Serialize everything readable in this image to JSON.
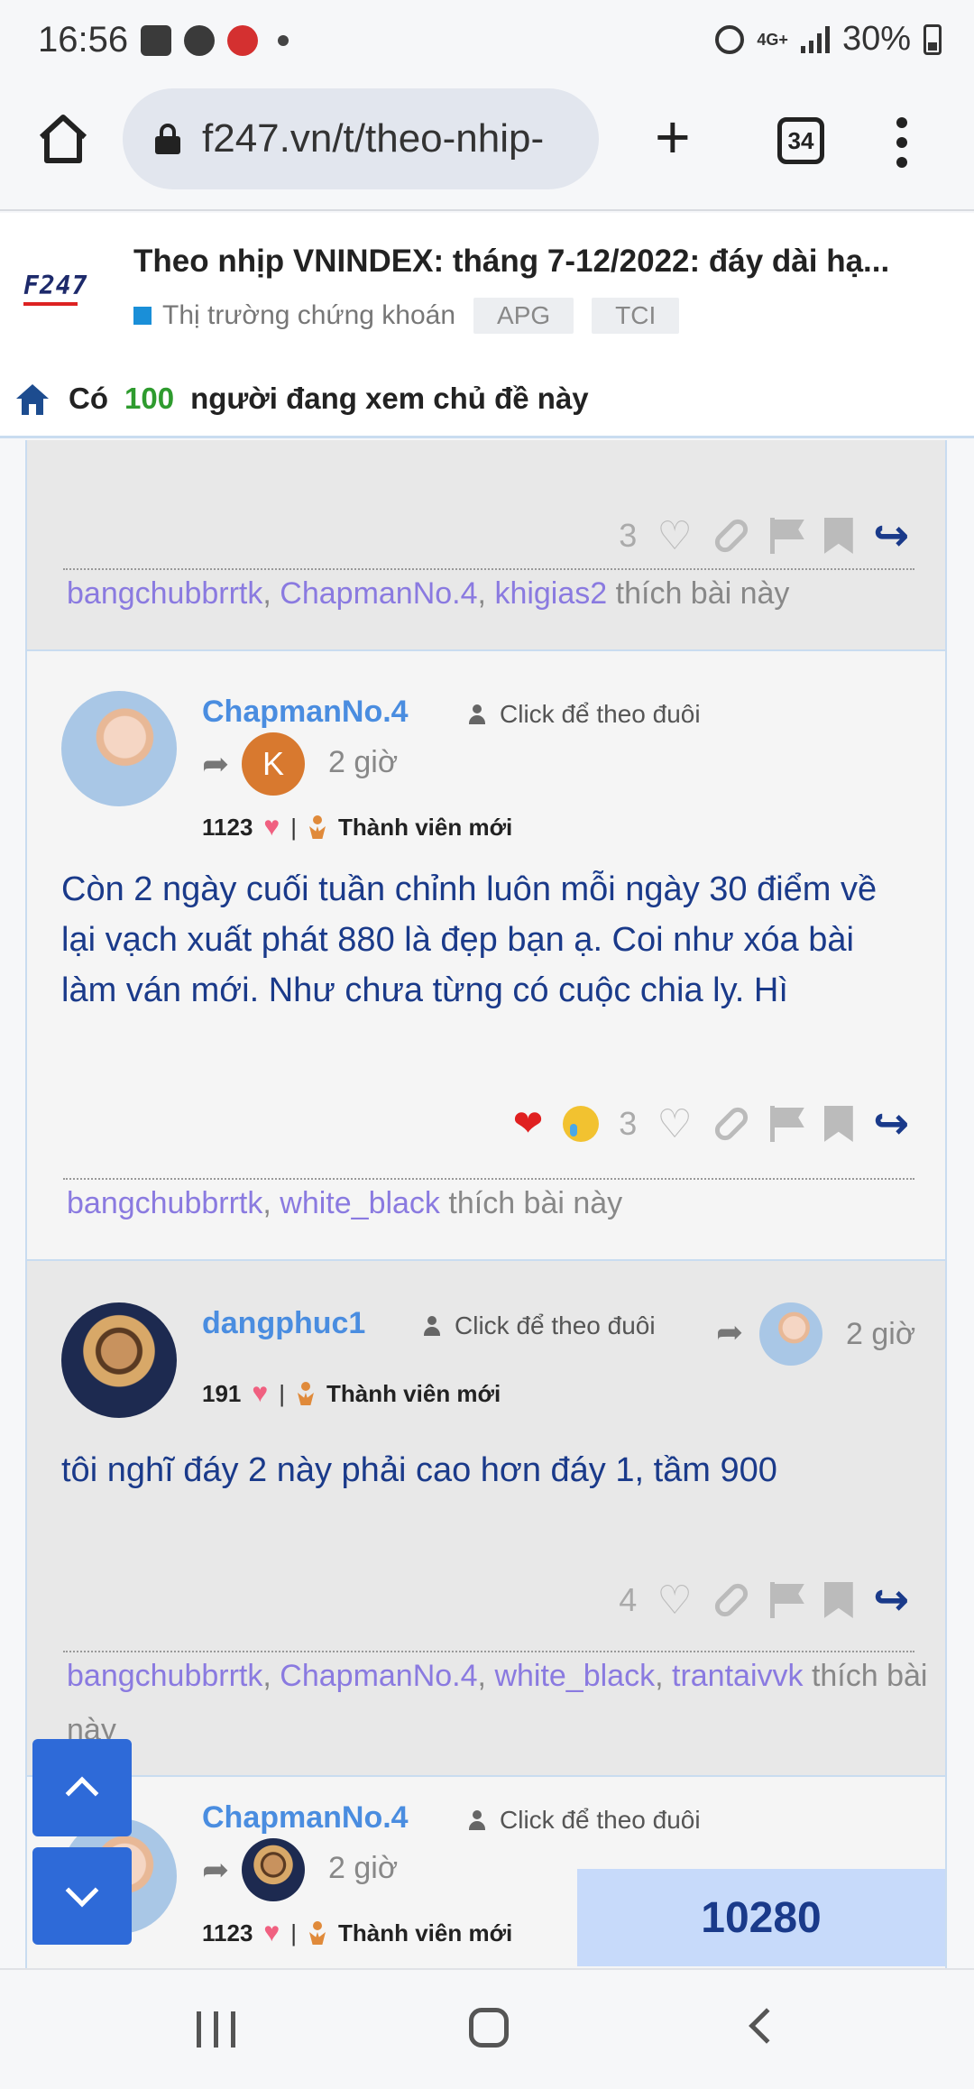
{
  "status_bar": {
    "time": "16:56",
    "network": "4G+",
    "battery": "30%"
  },
  "browser": {
    "url": "f247.vn/t/theo-nhip-",
    "tab_count": "34"
  },
  "header": {
    "thread_title": "Theo nhịp VNINDEX: tháng 7-12/2022: đáy dài hạ...",
    "category": "Thị trường chứng khoán",
    "tags": [
      "APG",
      "TCI"
    ],
    "viewers_prefix": "Có",
    "viewers_count": "100",
    "viewers_suffix": "người đang xem chủ đề này"
  },
  "posts": {
    "p0": {
      "like_count": "3",
      "likers": [
        "bangchubbrrtk",
        "ChapmanNo.4",
        "khigias2"
      ],
      "likes_suffix": "thích bài này"
    },
    "p1": {
      "username": "ChapmanNo.4",
      "follow_label": "Click để theo đuôi",
      "reply_to_initial": "K",
      "time": "2 giờ",
      "points": "1123",
      "rank": "Thành viên mới",
      "text": "Còn 2 ngày cuối tuần chỉnh luôn mỗi ngày 30 điểm về lại vạch xuất phát 880 là đẹp bạn ạ. Coi như xóa bài làm ván mới. Như chưa từng có cuộc chia ly. Hì",
      "reaction_count": "3",
      "likers": [
        "bangchubbrrtk",
        "white_black"
      ],
      "likes_suffix": "thích bài này"
    },
    "p2": {
      "username": "dangphuc1",
      "follow_label": "Click để theo đuôi",
      "time": "2 giờ",
      "points": "191",
      "rank": "Thành viên mới",
      "text": "tôi nghĩ đáy 2 này phải cao hơn đáy 1, tầm 900",
      "like_count": "4",
      "likers": [
        "bangchubbrrtk",
        "ChapmanNo.4",
        "white_black",
        "trantaivvk"
      ],
      "likes_suffix": "thích bài này"
    },
    "p3": {
      "username": "ChapmanNo.4",
      "follow_label": "Click để theo đuôi",
      "time": "2 giờ",
      "points": "1123",
      "rank": "Thành viên mới"
    }
  },
  "post_counter": "10280",
  "icons": {
    "home": "home-icon",
    "lock": "lock-icon",
    "new_tab": "plus-icon",
    "menu": "kebab-menu-icon",
    "reply": "reply-icon",
    "share": "share-arrow-icon"
  },
  "colors": {
    "username": "#4a8de0",
    "post_text": "#1a3a8a",
    "likers": "#8a7ae0",
    "viewers_count": "#2e9b2e",
    "scroll_buttons": "#2e6ad8",
    "counter_bg": "#c7dafa"
  }
}
